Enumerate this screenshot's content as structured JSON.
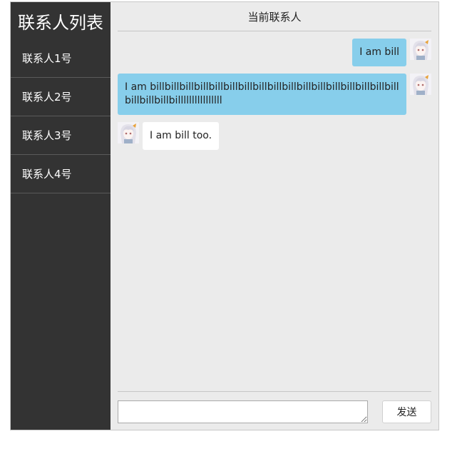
{
  "sidebar": {
    "title": "联系人列表",
    "items": [
      {
        "label": "联系人1号"
      },
      {
        "label": "联系人2号"
      },
      {
        "label": "联系人3号"
      },
      {
        "label": "联系人4号"
      }
    ]
  },
  "chat": {
    "header_title": "当前联系人",
    "messages": [
      {
        "side": "right",
        "text": "I am bill"
      },
      {
        "side": "right",
        "text": "I am billbillbillbillbillbillbillbillbillbillbillbillbillbillbillbillbillbillbillbillbillllllllllllllll"
      },
      {
        "side": "left",
        "text": "I am bill too."
      }
    ],
    "input_value": "",
    "send_label": "发送"
  },
  "colors": {
    "sidebar_bg": "#333333",
    "chat_bg": "#ebebeb",
    "self_bubble": "#87ceeb",
    "other_bubble": "#ffffff"
  }
}
